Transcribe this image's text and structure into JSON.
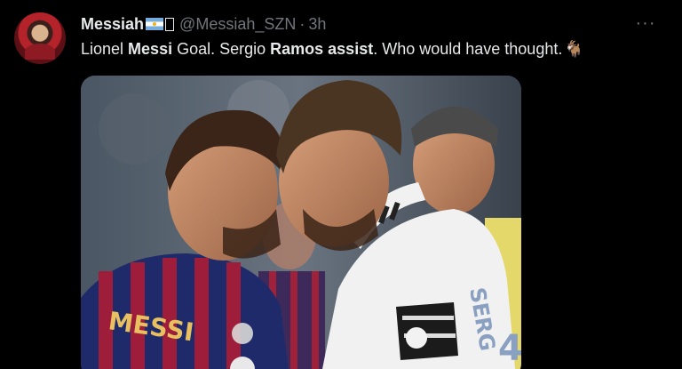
{
  "tweet": {
    "display_name": "Messiah",
    "handle": "@Messiah_SZN",
    "separator": "·",
    "time": "3h",
    "more_label": "···",
    "text_parts": [
      {
        "t": "Lionel ",
        "b": false
      },
      {
        "t": "Messi",
        "b": true
      },
      {
        "t": " Goal. Sergio ",
        "b": false
      },
      {
        "t": "Ramos assist",
        "b": true
      },
      {
        "t": ". Who would have thought.",
        "b": false
      }
    ],
    "emoji": "🐐"
  },
  "media": {
    "shirt_name": "MESSI",
    "shirt_name_2": "SERG",
    "shirt_number": "4"
  }
}
